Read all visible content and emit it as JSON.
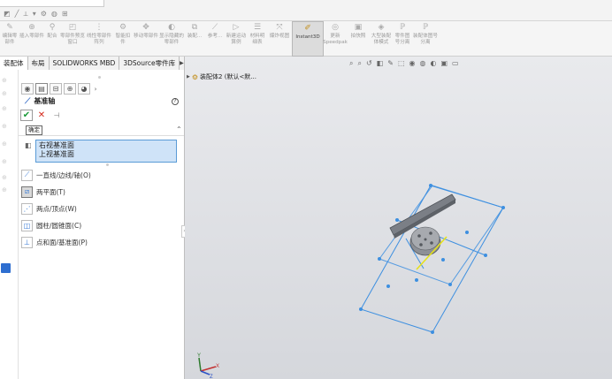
{
  "ribbon": {
    "items": [
      {
        "label": "编辑零部件",
        "icon": "edit-component-icon"
      },
      {
        "label": "插入零部件",
        "icon": "insert-component-icon"
      },
      {
        "label": "配合",
        "icon": "mate-icon"
      },
      {
        "label": "零部件预览窗口",
        "icon": "component-preview-icon"
      },
      {
        "label": "线性零部件阵列",
        "icon": "linear-pattern-icon"
      },
      {
        "label": "智能扣件",
        "icon": "smart-fastener-icon"
      },
      {
        "label": "移动零部件",
        "icon": "move-component-icon"
      },
      {
        "label": "显示隐藏的零部件",
        "icon": "show-hidden-icon"
      },
      {
        "label": "装配...",
        "icon": "assembly-feature-icon"
      },
      {
        "label": "参考...",
        "icon": "reference-geometry-icon"
      },
      {
        "label": "新建运动算例",
        "icon": "motion-study-icon"
      },
      {
        "label": "材料明细表",
        "icon": "bom-icon"
      },
      {
        "label": "爆炸视图",
        "icon": "exploded-view-icon"
      },
      {
        "label": "Instant3D",
        "icon": "instant3d-icon"
      },
      {
        "label": "更新Speedpak",
        "icon": "speedpak-icon"
      },
      {
        "label": "拍快照",
        "icon": "snapshot-icon"
      },
      {
        "label": "大型装配体模式",
        "icon": "large-assembly-icon"
      },
      {
        "label": "零件图号分离",
        "icon": "part-number-icon"
      },
      {
        "label": "装配体图号分离",
        "icon": "assembly-number-icon"
      }
    ]
  },
  "tabs": [
    "装配体",
    "布局",
    "SOLIDWORKS MBD",
    "3DSource零件库"
  ],
  "panel": {
    "title": "基准轴",
    "tooltip": "确定",
    "selection_header": "选择",
    "selections": [
      "右视基准面",
      "上视基准面"
    ],
    "options": [
      {
        "label": "一直线/边线/轴(O)",
        "icon": "line-edge-axis-icon"
      },
      {
        "label": "两平面(T)",
        "icon": "two-planes-icon"
      },
      {
        "label": "两点/顶点(W)",
        "icon": "two-points-icon"
      },
      {
        "label": "圆柱/圆锥面(C)",
        "icon": "cylinder-face-icon"
      },
      {
        "label": "点和面/基准面(P)",
        "icon": "point-face-icon"
      }
    ]
  },
  "viewport": {
    "tree_label": "装配体2 (默认<默..."
  }
}
